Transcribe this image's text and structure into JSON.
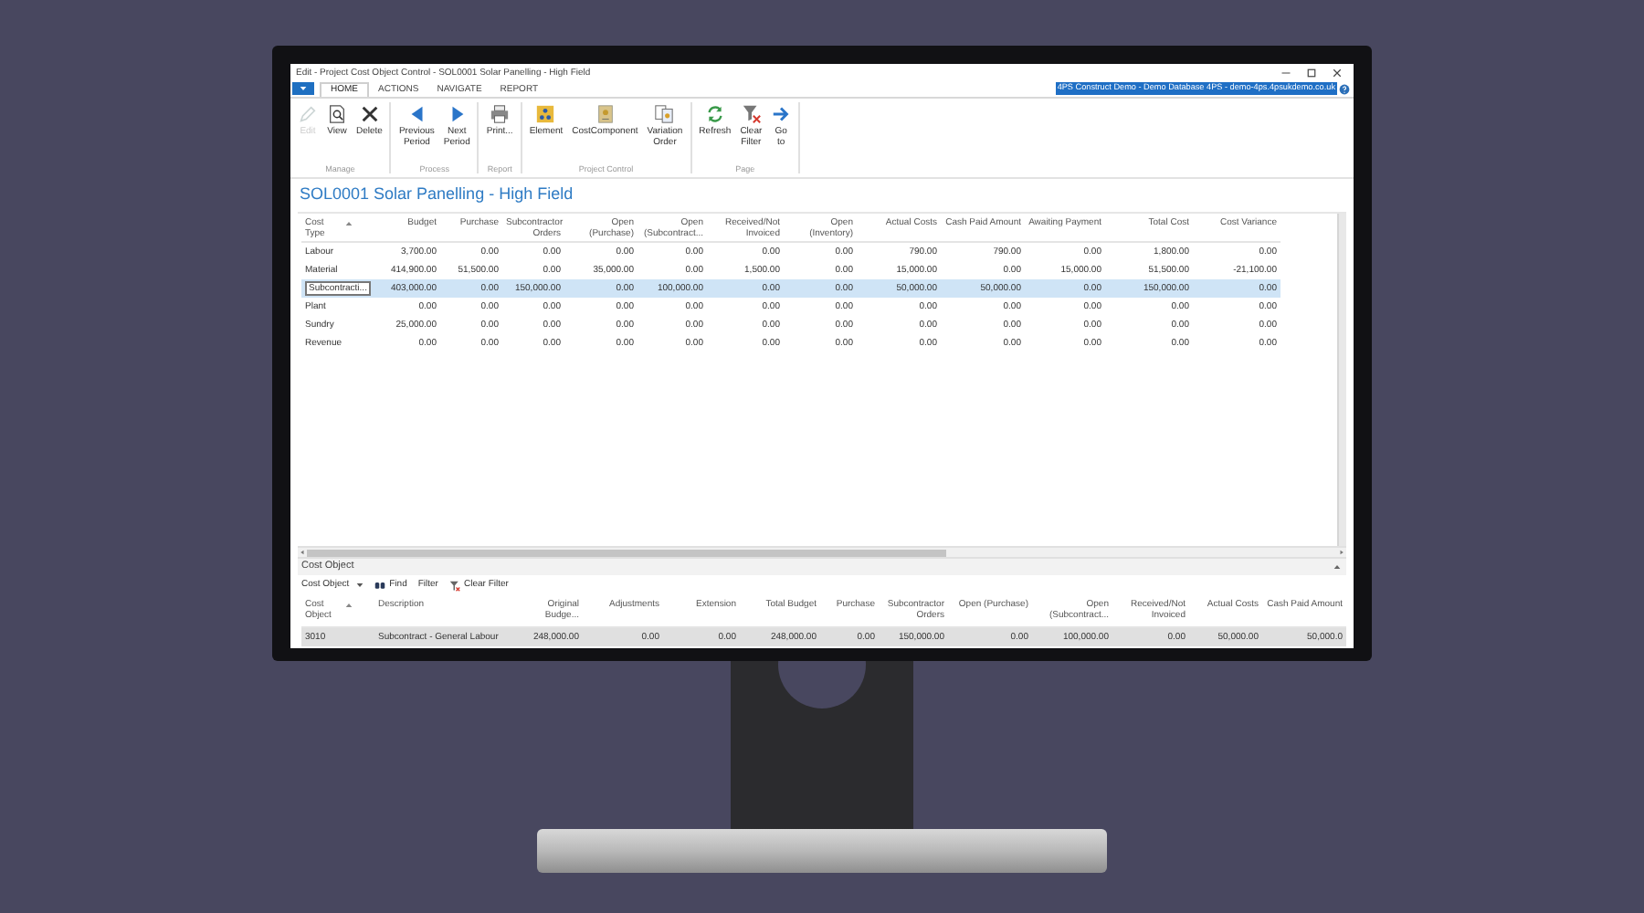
{
  "window": {
    "title": "Edit - Project Cost Object Control - SOL0001 Solar Panelling - High Field"
  },
  "tabs": [
    {
      "label": "HOME",
      "selected": true
    },
    {
      "label": "ACTIONS",
      "selected": false
    },
    {
      "label": "NAVIGATE",
      "selected": false
    },
    {
      "label": "REPORT",
      "selected": false
    }
  ],
  "connection": "4PS Construct Demo - Demo Database 4PS - demo-4ps.4psukdemo.co.uk",
  "ribbon_groups": [
    {
      "label": "Manage",
      "buttons": [
        {
          "label": "Edit",
          "disabled": true
        },
        {
          "label": "View",
          "disabled": false
        },
        {
          "label": "Delete",
          "disabled": false
        }
      ]
    },
    {
      "label": "Process",
      "buttons": [
        {
          "label": "Previous Period",
          "disabled": false
        },
        {
          "label": "Next Period",
          "disabled": false
        }
      ]
    },
    {
      "label": "Report",
      "buttons": [
        {
          "label": "Print...",
          "disabled": false
        }
      ]
    },
    {
      "label": "Project Control",
      "buttons": [
        {
          "label": "Element",
          "disabled": false
        },
        {
          "label": "CostComponent",
          "disabled": false
        },
        {
          "label": "Variation Order",
          "disabled": false
        }
      ]
    },
    {
      "label": "Page",
      "buttons": [
        {
          "label": "Refresh",
          "disabled": false
        },
        {
          "label": "Clear Filter",
          "disabled": false
        },
        {
          "label": "Go to",
          "disabled": false
        }
      ]
    }
  ],
  "page_title": "SOL0001 Solar Panelling - High Field",
  "table": {
    "columns": [
      "Cost Type",
      "Budget",
      "Purchase",
      "Subcontractor Orders",
      "Open (Purchase)",
      "Open (Subcontract...",
      "Received/Not Invoiced",
      "Open (Inventory)",
      "Actual Costs",
      "Cash Paid Amount",
      "Awaiting Payment",
      "Total Cost",
      "Cost Variance"
    ],
    "rows": [
      {
        "selected": false,
        "cells": [
          "Labour",
          "3,700.00",
          "0.00",
          "0.00",
          "0.00",
          "0.00",
          "0.00",
          "0.00",
          "790.00",
          "790.00",
          "0.00",
          "1,800.00",
          "0.00"
        ]
      },
      {
        "selected": false,
        "cells": [
          "Material",
          "414,900.00",
          "51,500.00",
          "0.00",
          "35,000.00",
          "0.00",
          "1,500.00",
          "0.00",
          "15,000.00",
          "0.00",
          "15,000.00",
          "51,500.00",
          "-21,100.00"
        ]
      },
      {
        "selected": true,
        "cells": [
          "Subcontracti...",
          "403,000.00",
          "0.00",
          "150,000.00",
          "0.00",
          "100,000.00",
          "0.00",
          "0.00",
          "50,000.00",
          "50,000.00",
          "0.00",
          "150,000.00",
          "0.00"
        ]
      },
      {
        "selected": false,
        "cells": [
          "Plant",
          "0.00",
          "0.00",
          "0.00",
          "0.00",
          "0.00",
          "0.00",
          "0.00",
          "0.00",
          "0.00",
          "0.00",
          "0.00",
          "0.00"
        ]
      },
      {
        "selected": false,
        "cells": [
          "Sundry",
          "25,000.00",
          "0.00",
          "0.00",
          "0.00",
          "0.00",
          "0.00",
          "0.00",
          "0.00",
          "0.00",
          "0.00",
          "0.00",
          "0.00"
        ]
      },
      {
        "selected": false,
        "cells": [
          "Revenue",
          "0.00",
          "0.00",
          "0.00",
          "0.00",
          "0.00",
          "0.00",
          "0.00",
          "0.00",
          "0.00",
          "0.00",
          "0.00",
          "0.00"
        ]
      }
    ]
  },
  "cost_object": {
    "title": "Cost Object",
    "toolbar": [
      {
        "label": "Cost Object",
        "kind": "dropdown"
      },
      {
        "label": "Find",
        "kind": "find"
      },
      {
        "label": "Filter",
        "kind": "plain"
      },
      {
        "label": "Clear Filter",
        "kind": "clear-filter"
      }
    ],
    "columns": [
      "Cost Object",
      "Description",
      "Original Budge...",
      "Adjustments",
      "Extension",
      "Total Budget",
      "Purchase",
      "Subcontractor Orders",
      "Open (Purchase)",
      "Open (Subcontract...",
      "Received/Not Invoiced",
      "Actual Costs",
      "Cash Paid Amount"
    ],
    "rows": [
      {
        "selected": true,
        "cells": [
          "3010",
          "Subcontract - General Labour",
          "248,000.00",
          "0.00",
          "0.00",
          "248,000.00",
          "0.00",
          "150,000.00",
          "0.00",
          "100,000.00",
          "0.00",
          "50,000.00",
          "50,000.0"
        ]
      }
    ]
  }
}
